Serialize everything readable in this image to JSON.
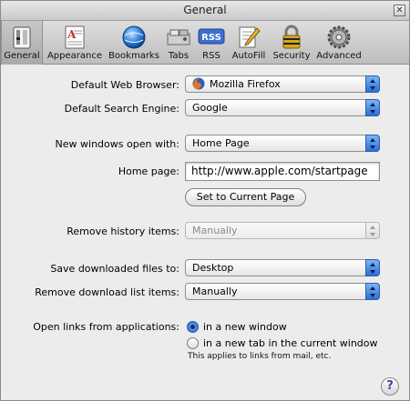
{
  "window": {
    "title": "General"
  },
  "toolbar": {
    "items": [
      {
        "label": "General",
        "icon": "general-icon",
        "selected": true
      },
      {
        "label": "Appearance",
        "icon": "appearance-icon"
      },
      {
        "label": "Bookmarks",
        "icon": "bookmarks-icon"
      },
      {
        "label": "Tabs",
        "icon": "tabs-icon"
      },
      {
        "label": "RSS",
        "icon": "rss-icon"
      },
      {
        "label": "AutoFill",
        "icon": "autofill-icon"
      },
      {
        "label": "Security",
        "icon": "security-icon"
      },
      {
        "label": "Advanced",
        "icon": "advanced-icon"
      }
    ],
    "rss_badge": "RSS"
  },
  "settings": {
    "default_browser": {
      "label": "Default Web Browser:",
      "value": "Mozilla Firefox"
    },
    "default_search": {
      "label": "Default Search Engine:",
      "value": "Google"
    },
    "new_windows": {
      "label": "New windows open with:",
      "value": "Home Page"
    },
    "home_page": {
      "label": "Home page:",
      "value": "http://www.apple.com/startpage"
    },
    "set_current": {
      "label": "Set to Current Page"
    },
    "remove_history": {
      "label": "Remove history items:",
      "value": "Manually",
      "disabled": true
    },
    "save_downloads": {
      "label": "Save downloaded files to:",
      "value": "Desktop"
    },
    "remove_downloads": {
      "label": "Remove download list items:",
      "value": "Manually"
    },
    "open_links": {
      "label": "Open links from applications:",
      "options": [
        "in a new window",
        "in a new tab in the current window"
      ],
      "selected": 0,
      "note": "This applies to links from mail, etc."
    }
  },
  "help": {
    "label": "?"
  },
  "colors": {
    "accent": "#2a6fd6"
  }
}
